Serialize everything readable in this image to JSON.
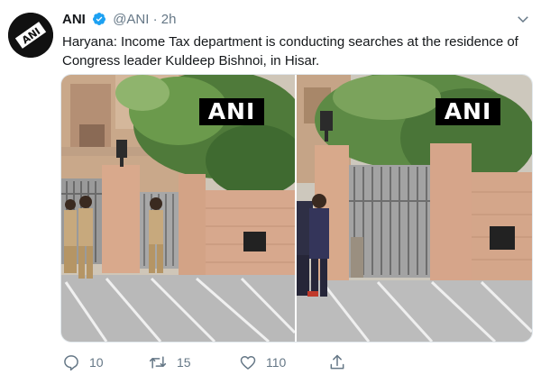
{
  "tweet": {
    "author_name": "ANI",
    "handle": "@ANI",
    "separator": "·",
    "time": "2h",
    "text_line1": "Haryana: Income Tax department is conducting searches at the residence of",
    "text_line2": "Congress leader Kuldeep Bishnoi, in Hisar.",
    "avatar_text": "ANI"
  },
  "media": {
    "left_watermark": "ANI",
    "right_watermark": "ANI"
  },
  "actions": {
    "reply_count": "10",
    "retweet_count": "15",
    "like_count": "110"
  },
  "icons": {
    "verified": "verified-badge-icon",
    "caret": "chevron-down-icon",
    "reply": "reply-icon",
    "retweet": "retweet-icon",
    "like": "heart-icon",
    "share": "share-icon"
  },
  "colors": {
    "verified": "#1da1f2",
    "secondary_text": "#657786",
    "primary_text": "#14171a"
  }
}
